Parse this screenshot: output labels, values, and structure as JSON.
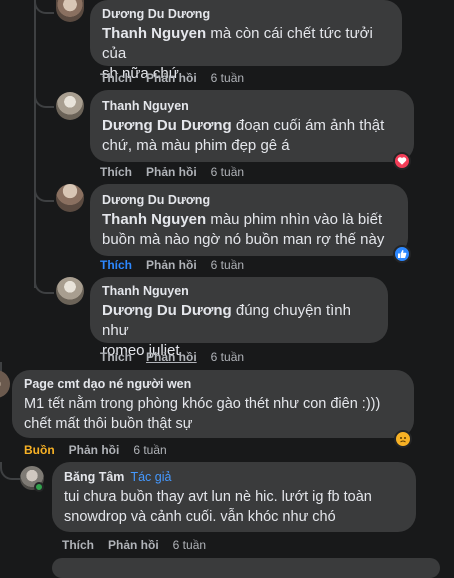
{
  "comments": [
    {
      "author": "Dương Du Dương",
      "mention": "Thanh Nguyen",
      "text_lines": [
        " mà còn cái chết tức tưởi của",
        "sh nữa chứ"
      ],
      "actions": {
        "like": "Thích",
        "reply": "Phản hồi",
        "time": "6 tuần"
      }
    },
    {
      "author": "Thanh Nguyen",
      "mention": "Dương Du Dương",
      "text_lines": [
        " đoạn cuối ám ảnh thật",
        "chứ, mà màu phim đẹp gê á"
      ],
      "actions": {
        "like": "Thích",
        "reply": "Phản hồi",
        "time": "6 tuần"
      },
      "reaction": "love"
    },
    {
      "author": "Dương Du Dương",
      "mention": "Thanh Nguyen",
      "text_lines": [
        " màu phim nhìn vào là biết",
        "buồn mà nào ngờ nó buồn man rợ thế này"
      ],
      "actions": {
        "like": "Thích",
        "reply": "Phản hồi",
        "time": "6 tuần"
      },
      "reaction": "like"
    },
    {
      "author": "Thanh Nguyen",
      "mention": "Dương Du Dương",
      "text_lines": [
        " đúng chuyện tình như",
        "romeo juliet"
      ],
      "actions": {
        "like": "Thích",
        "reply": "Phản hồi",
        "time": "6 tuần"
      }
    },
    {
      "author": "Page cmt dạo né người wen",
      "text_lines": [
        "M1 tết nằm trong phòng khóc gào thét như con điên :)))",
        "chết mất thôi buồn thật sự"
      ],
      "actions": {
        "like": "Buồn",
        "reply": "Phản hồi",
        "time": "6 tuần"
      },
      "reaction": "sad"
    },
    {
      "author": "Băng Tâm",
      "badge": "Tác giả",
      "text_lines": [
        "tui chưa buồn thay avt lun nè hic. lướt ig fb toàn",
        "snowdrop và cảnh cuối. vẫn khóc như chó"
      ],
      "actions": {
        "like": "Thích",
        "reply": "Phản hồi",
        "time": "6 tuần"
      }
    }
  ],
  "colors": {
    "background": "#18191a",
    "bubble": "#3a3b3c",
    "text": "#e4e6eb",
    "muted": "#b0b3b8",
    "link_blue": "#2d88ff",
    "sad_yellow": "#f7b125",
    "love_red": "#f33e58"
  }
}
